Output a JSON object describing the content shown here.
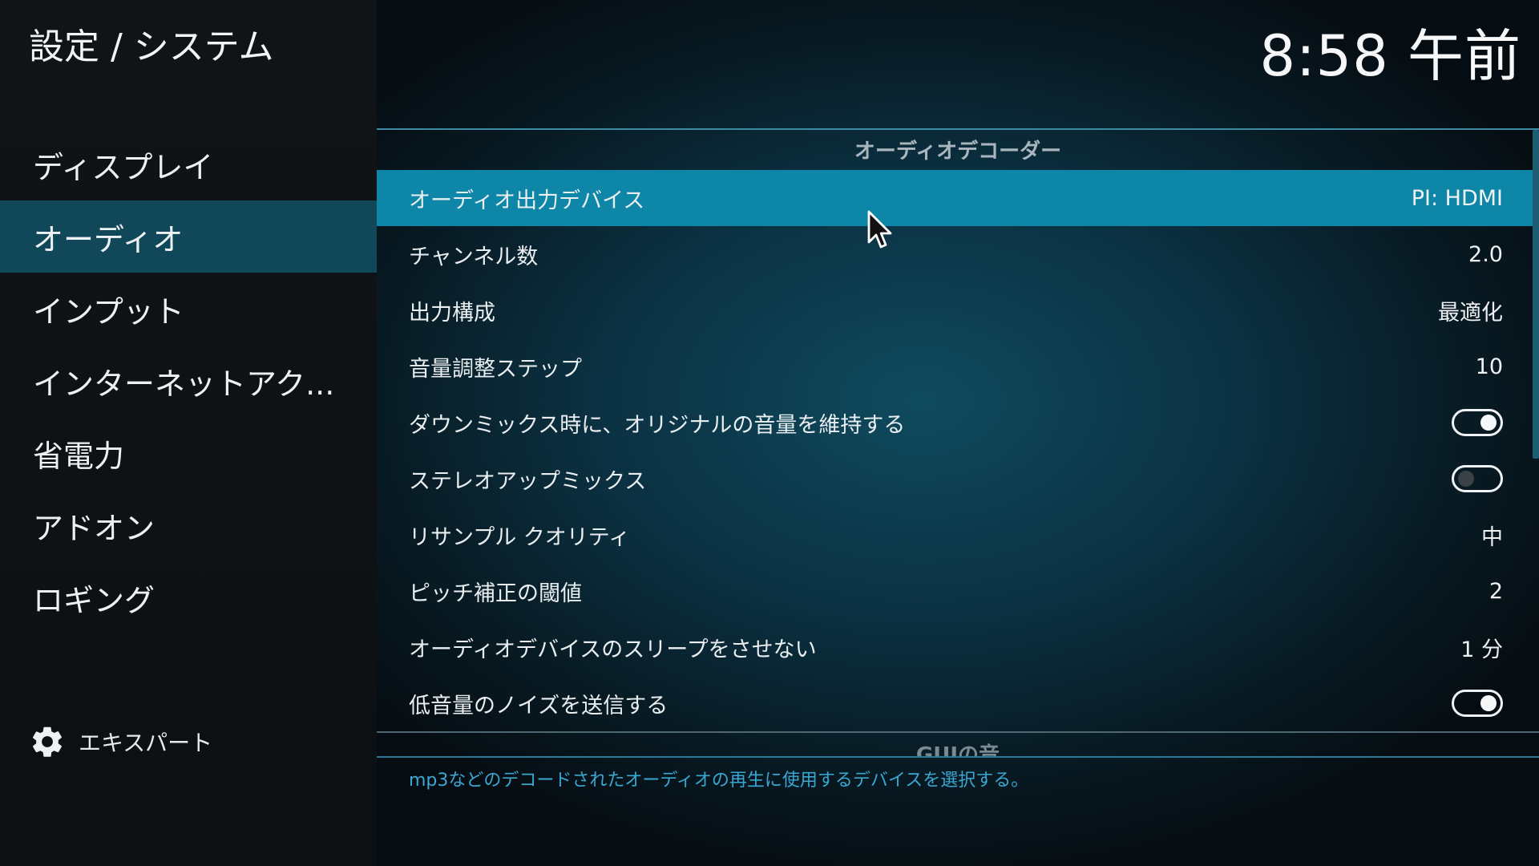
{
  "header": {
    "title": "設定 / システム",
    "clock": "8:58 午前"
  },
  "sidebar": {
    "items": [
      {
        "label": "ディスプレイ"
      },
      {
        "label": "オーディオ"
      },
      {
        "label": "インプット"
      },
      {
        "label": "インターネットアク..."
      },
      {
        "label": "省電力"
      },
      {
        "label": "アドオン"
      },
      {
        "label": "ロギング"
      }
    ],
    "active_item": "オーディオ",
    "expert_label": "エキスパート"
  },
  "settings": {
    "group_header": "オーディオデコーダー",
    "rows": [
      {
        "label": "オーディオ出力デバイス",
        "value": "PI: HDMI",
        "focused": true
      },
      {
        "label": "チャンネル数",
        "value": "2.0"
      },
      {
        "label": "出力構成",
        "value": "最適化"
      },
      {
        "label": "音量調整ステップ",
        "value": "10"
      },
      {
        "label": "ダウンミックス時に、オリジナルの音量を維持する",
        "toggle": "on"
      },
      {
        "label": "ステレオアップミックス",
        "toggle": "off"
      },
      {
        "label": "リサンプル クオリティ",
        "value": "中"
      },
      {
        "label": "ピッチ補正の閾値",
        "value": "2"
      },
      {
        "label": "オーディオデバイスのスリープをさせない",
        "value": "1 分"
      },
      {
        "label": "低音量のノイズを送信する",
        "toggle": "on"
      }
    ],
    "next_group": "GUIの音",
    "description": "mp3などのデコードされたオーディオの再生に使用するデバイスを選択する。"
  },
  "colors": {
    "focus": "#0e86a8",
    "sidebar_active": "#10485a",
    "description_text": "#3aa7d2"
  }
}
